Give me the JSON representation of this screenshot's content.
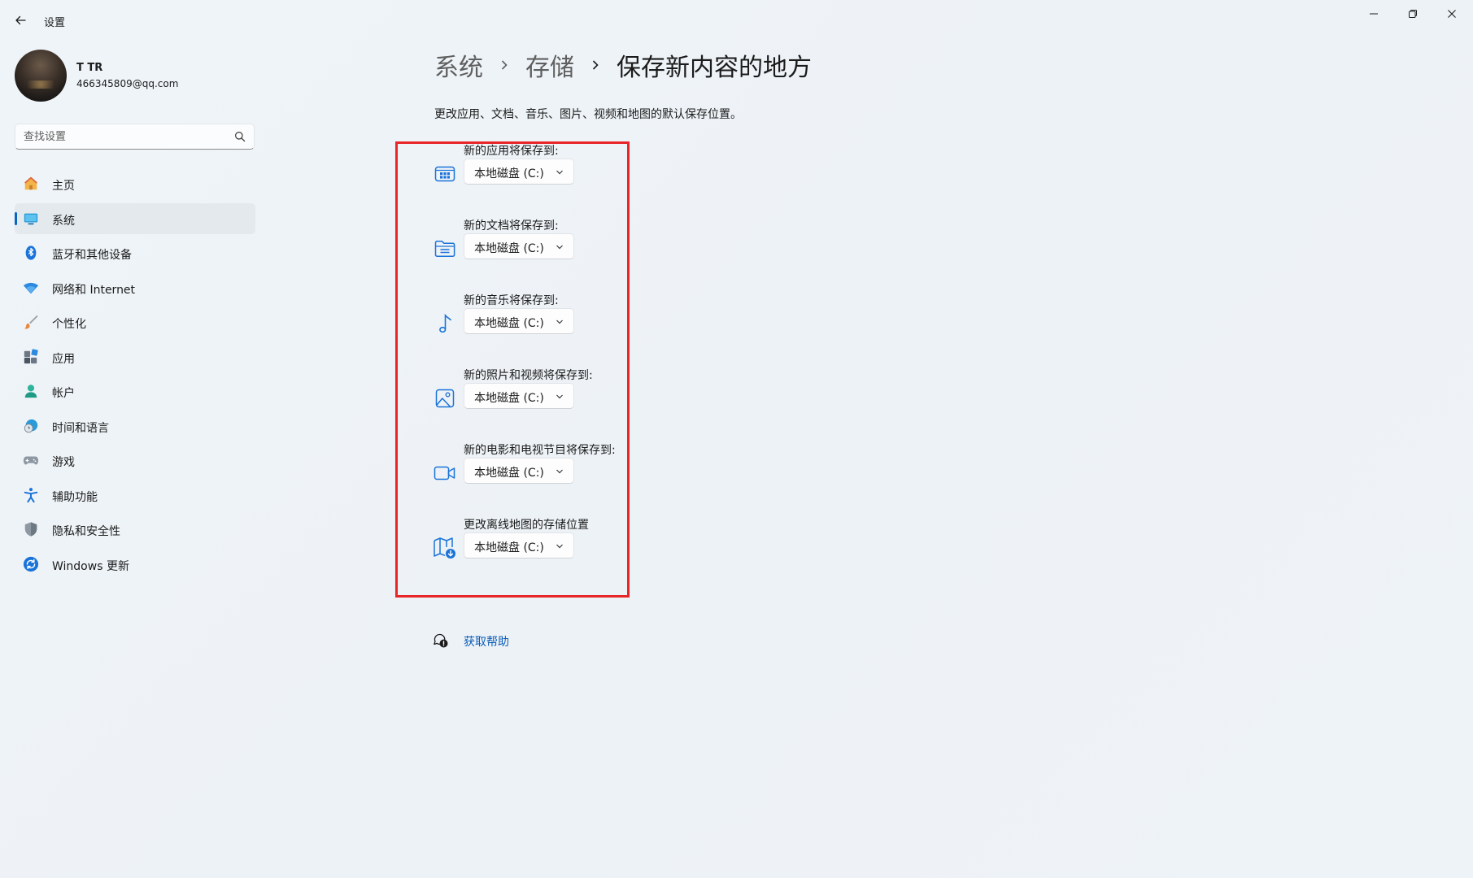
{
  "window": {
    "title": "设置",
    "controls": [
      "minimize",
      "maximize",
      "close"
    ]
  },
  "profile": {
    "name": "T TR",
    "email": "466345809@qq.com"
  },
  "search": {
    "placeholder": "查找设置"
  },
  "sidebar": {
    "items": [
      {
        "label": "主页",
        "icon": "home-icon",
        "active": false
      },
      {
        "label": "系统",
        "icon": "system-icon",
        "active": true
      },
      {
        "label": "蓝牙和其他设备",
        "icon": "bluetooth-icon",
        "active": false
      },
      {
        "label": "网络和 Internet",
        "icon": "wifi-icon",
        "active": false
      },
      {
        "label": "个性化",
        "icon": "brush-icon",
        "active": false
      },
      {
        "label": "应用",
        "icon": "apps-icon",
        "active": false
      },
      {
        "label": "帐户",
        "icon": "account-icon",
        "active": false
      },
      {
        "label": "时间和语言",
        "icon": "time-language-icon",
        "active": false
      },
      {
        "label": "游戏",
        "icon": "gamepad-icon",
        "active": false
      },
      {
        "label": "辅助功能",
        "icon": "accessibility-icon",
        "active": false
      },
      {
        "label": "隐私和安全性",
        "icon": "shield-icon",
        "active": false
      },
      {
        "label": "Windows 更新",
        "icon": "update-icon",
        "active": false
      }
    ]
  },
  "breadcrumb": {
    "items": [
      "系统",
      "存储"
    ],
    "current": "保存新内容的地方"
  },
  "description": "更改应用、文档、音乐、图片、视频和地图的默认保存位置。",
  "settings": [
    {
      "label": "新的应用将保存到:",
      "value": "本地磁盘 (C:)",
      "icon": "apps-storage-icon"
    },
    {
      "label": "新的文档将保存到:",
      "value": "本地磁盘 (C:)",
      "icon": "folder-icon"
    },
    {
      "label": "新的音乐将保存到:",
      "value": "本地磁盘 (C:)",
      "icon": "music-note-icon"
    },
    {
      "label": "新的照片和视频将保存到:",
      "value": "本地磁盘 (C:)",
      "icon": "photo-icon"
    },
    {
      "label": "新的电影和电视节目将保存到:",
      "value": "本地磁盘 (C:)",
      "icon": "video-camera-icon"
    },
    {
      "label": "更改离线地图的存储位置",
      "value": "本地磁盘 (C:)",
      "icon": "map-download-icon"
    }
  ],
  "help": {
    "label": "获取帮助",
    "icon": "help-icon"
  },
  "colors": {
    "accent": "#0a64c2",
    "highlight_border": "#e8262a",
    "link": "#0a5cb8"
  }
}
